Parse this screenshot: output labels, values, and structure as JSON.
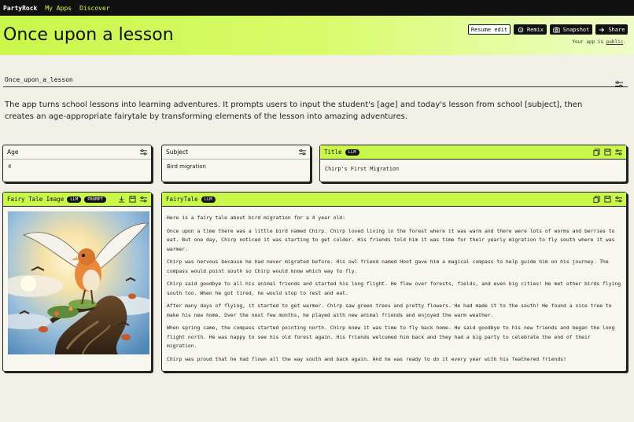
{
  "nav": {
    "brand": "PartyRock",
    "my_apps": "My Apps",
    "discover": "Discover"
  },
  "header": {
    "title": "Once upon a lesson",
    "resume_edit": "Resume edit",
    "remix": "Remix",
    "snapshot": "Snapshot",
    "share": "Share",
    "public_prefix": "Your app is ",
    "public_word": "public",
    "public_suffix": "."
  },
  "app": {
    "name": "Once_upon_a_lesson",
    "description": "The app turns school lessons into learning adventures. It prompts users to input the student's [age] and today's lesson from school [subject], then creates an age-appropriate fairytale by transforming elements of the lesson into amazing adventures."
  },
  "widgets": {
    "age": {
      "label": "Age",
      "value": "4"
    },
    "subject": {
      "label": "Subject",
      "value": "Bird migration"
    },
    "title": {
      "label": "Title",
      "badge": "LLM",
      "value": "Chirp's First Migration"
    },
    "image": {
      "label": "Fairy Tale Image",
      "badge1": "LLM",
      "badge2": "PROMPT"
    },
    "fairytale": {
      "label": "FairyTale",
      "badge": "LLM",
      "paragraphs": [
        "Here is a fairy tale about bird migration for a 4 year old:",
        "Once upon a time there was a little bird named Chirp. Chirp loved living in the forest where it was warm and there were lots of worms and berries to eat. But one day, Chirp noticed it was starting to get colder. His friends told him it was time for their yearly migration to fly south where it was warmer.",
        "Chirp was nervous because he had never migrated before. His owl friend named Hoot gave him a magical compass to help guide him on his journey. The compass would point south so Chirp would know which way to fly.",
        "Chirp said goodbye to all his animal friends and started his long flight. He flew over forests, fields, and even big cities! He met other birds flying south too. When he got tired, he would stop to rest and eat.",
        "After many days of flying, it started to get warmer. Chirp saw green trees and pretty flowers. He had made it to the south! He found a nice tree to make his new home. Over the next few months, he played with new animal friends and enjoyed the warm weather.",
        "When spring came, the compass started pointing north. Chirp knew it was time to fly back home. He said goodbye to his new friends and began the long flight north. He was happy to see his old forest again. His friends welcomed him back and they had a big party to celebrate the end of their migration.",
        "Chirp was proud that he had flown all the way south and back again. And he was ready to do it every year with his feathered friends!"
      ]
    }
  },
  "colors": {
    "accent": "#c9f74a",
    "dark": "#111111",
    "background": "#f2f0e6"
  }
}
